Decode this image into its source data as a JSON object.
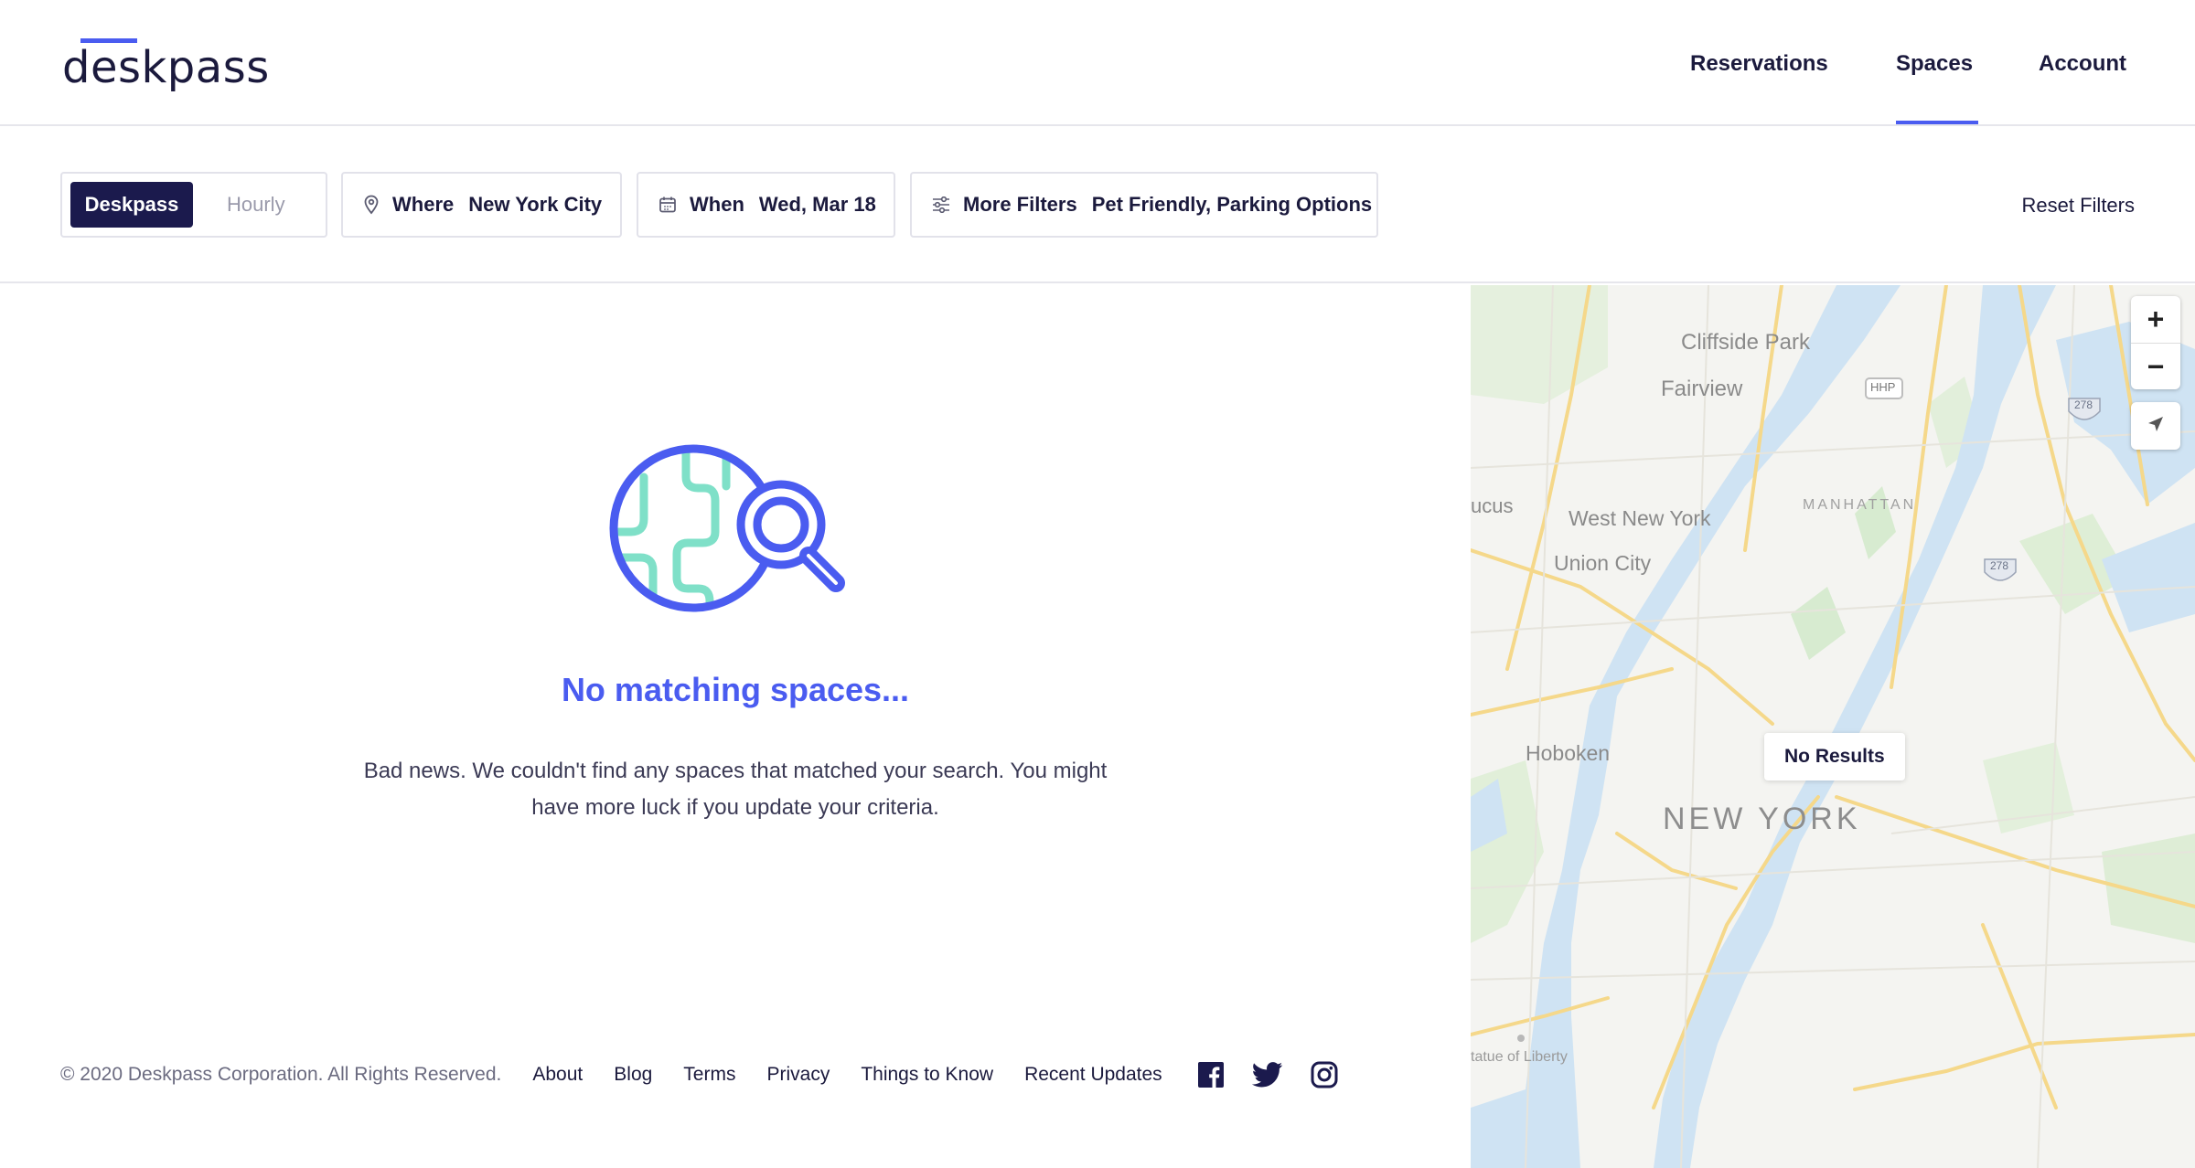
{
  "brand": {
    "name": "deskpass"
  },
  "nav": {
    "items": [
      "Reservations",
      "Spaces",
      "Account"
    ],
    "active": "Spaces"
  },
  "filters": {
    "toggle": {
      "active": "Deskpass",
      "inactive": "Hourly"
    },
    "where": {
      "label": "Where",
      "value": "New York City"
    },
    "when": {
      "label": "When",
      "value": "Wed, Mar 18"
    },
    "more": {
      "label": "More Filters",
      "value": "Pet Friendly, Parking Options"
    },
    "reset": "Reset Filters"
  },
  "empty_state": {
    "title": "No matching spaces...",
    "body": "Bad news. We couldn't find any spaces that matched your search. You might have more luck if you update your criteria."
  },
  "footer": {
    "copyright": "© 2020 Deskpass Corporation. All Rights Reserved.",
    "links": [
      "About",
      "Blog",
      "Terms",
      "Privacy",
      "Things to Know",
      "Recent Updates"
    ],
    "social_icons": [
      "facebook-icon",
      "twitter-icon",
      "instagram-icon"
    ]
  },
  "map": {
    "badge": "No Results",
    "zoom_in": "+",
    "zoom_out": "−",
    "labels": {
      "cliffside_park": "Cliffside Park",
      "fairview": "Fairview",
      "west_new_york": "West New York",
      "union_city": "Union City",
      "manhattan": "MANHATTAN",
      "hoboken": "Hoboken",
      "new_york": "NEW YORK",
      "secaucus": "ucus",
      "statue": "tatue of Liberty",
      "hhp": "HHP",
      "i278a": "278",
      "i278b": "278"
    }
  },
  "colors": {
    "accent": "#4a5cf0",
    "navy": "#1b1a4d",
    "water": "#c8dff2",
    "park": "#d6ecd2",
    "road": "#f6d98c"
  }
}
